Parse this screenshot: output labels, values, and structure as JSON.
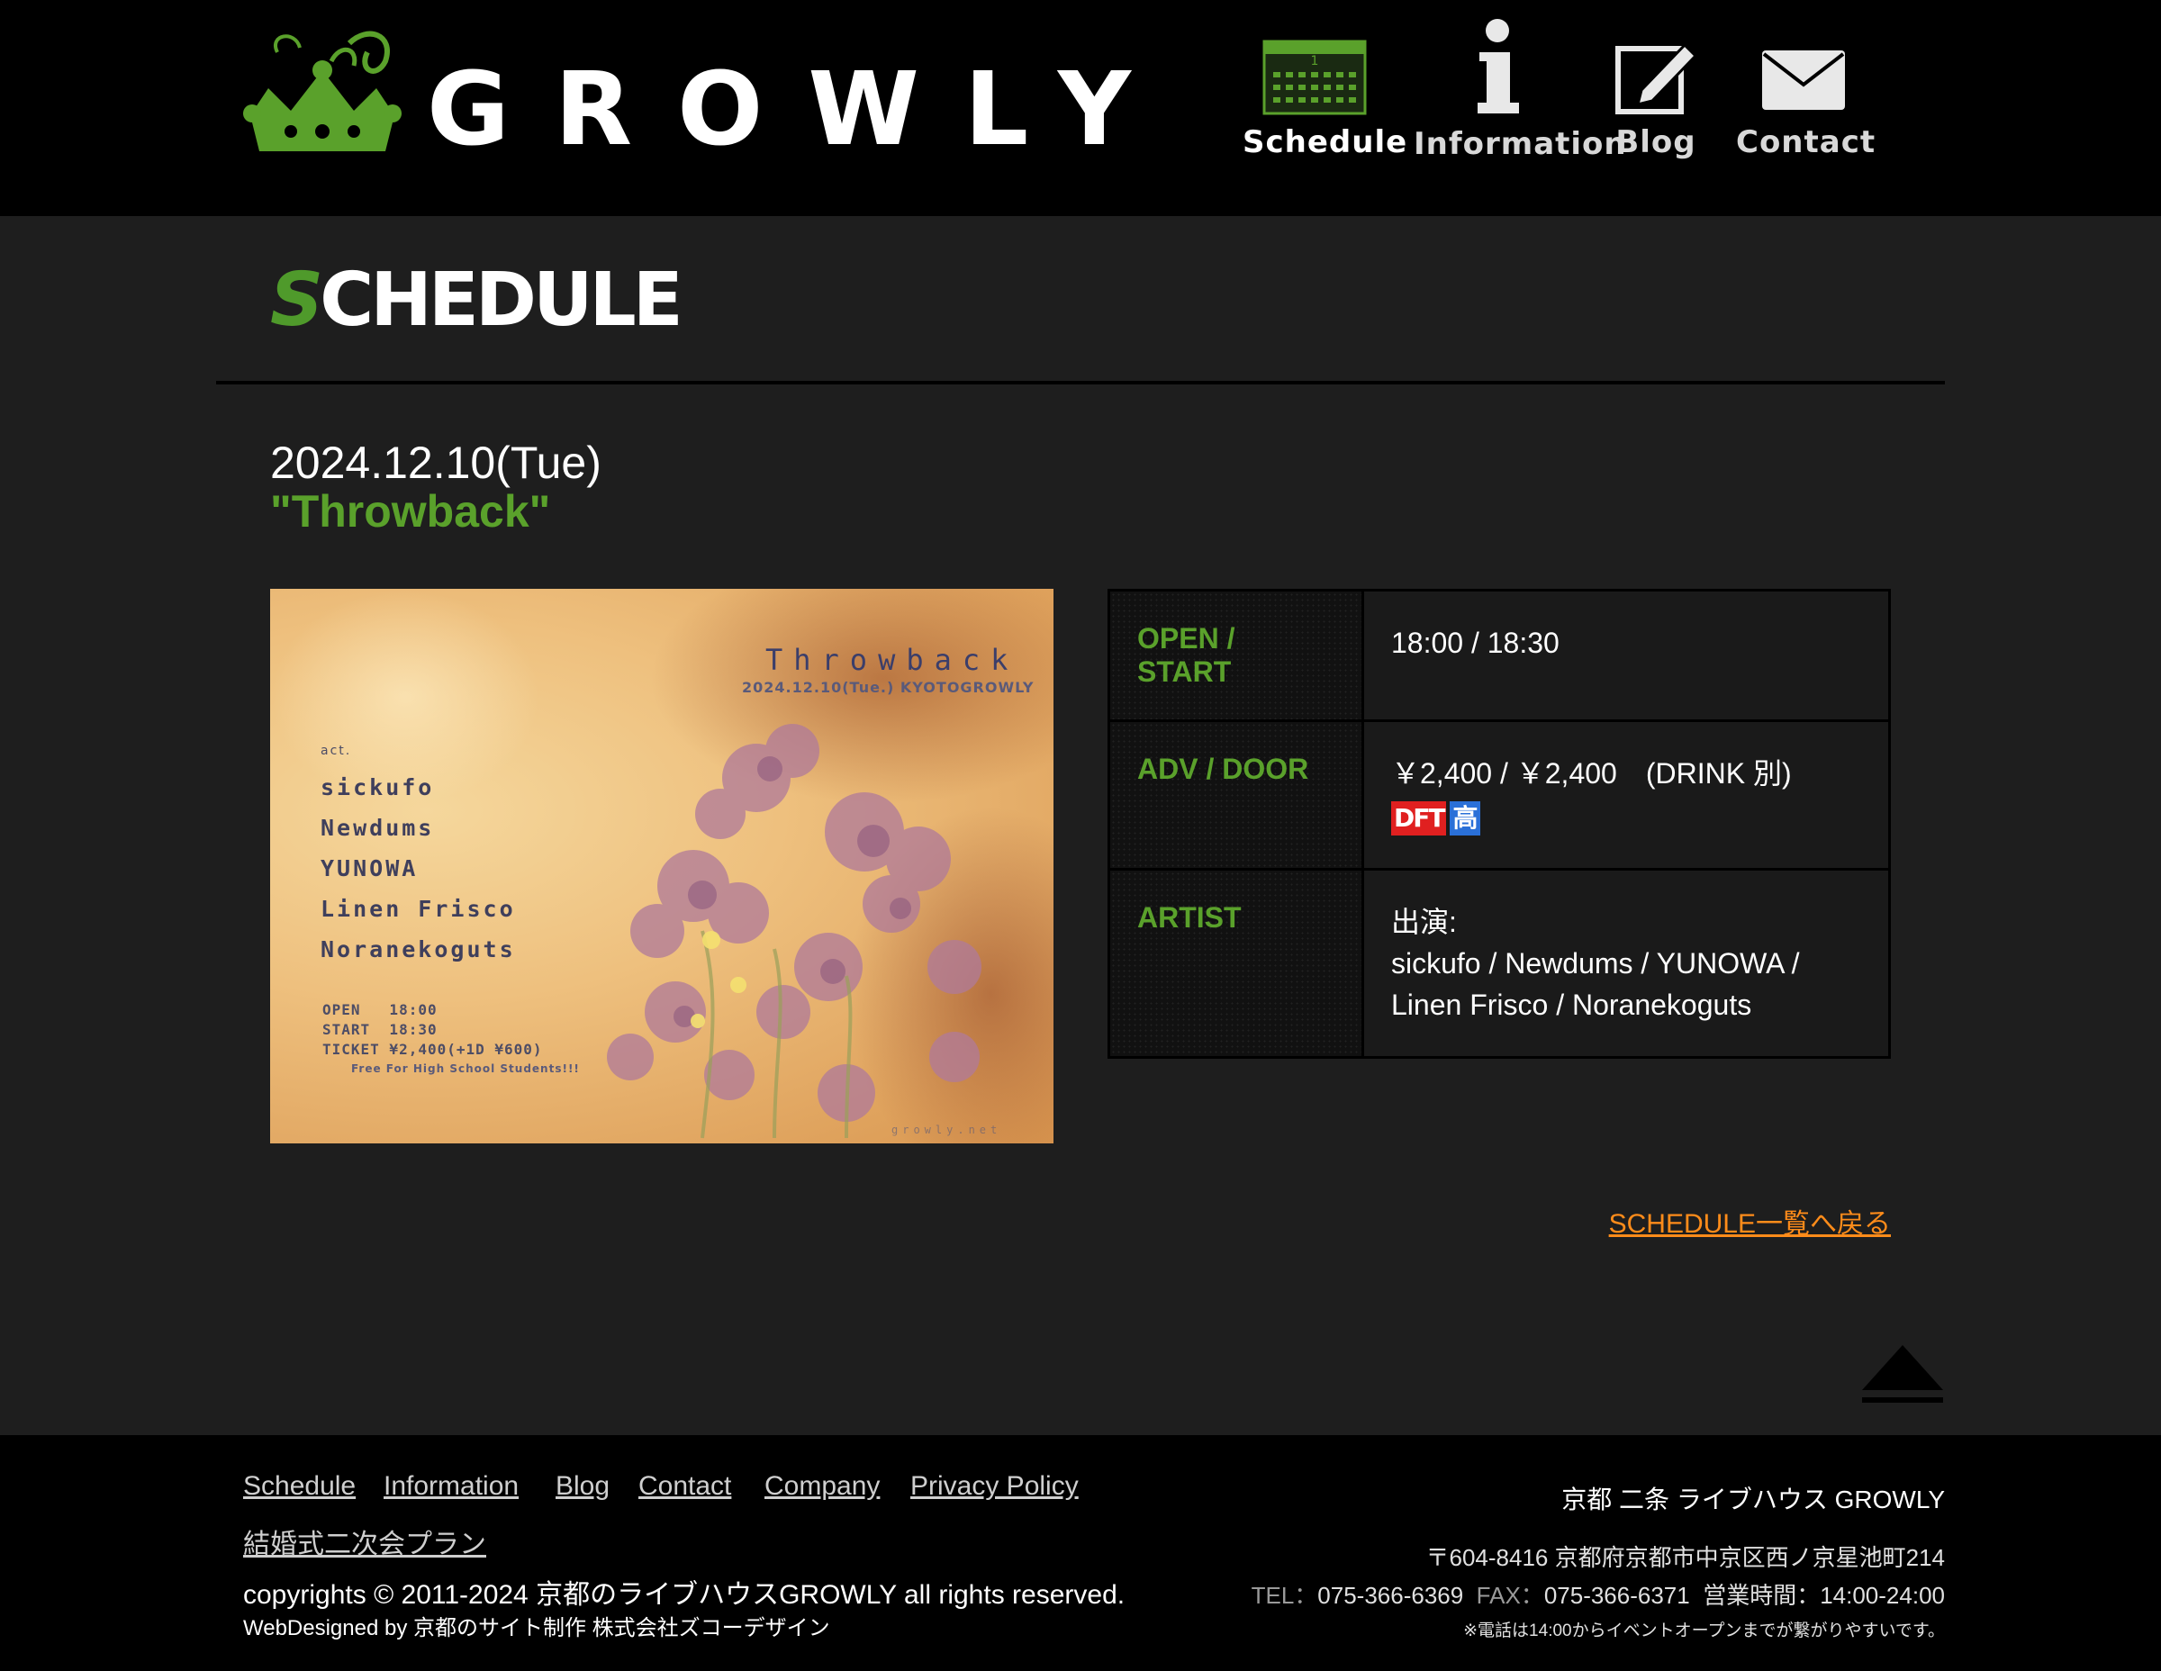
{
  "header": {
    "logo_text": "GROWLY",
    "nav": [
      {
        "label": "Schedule",
        "icon": "calendar-icon"
      },
      {
        "label": "Information",
        "icon": "info-icon"
      },
      {
        "label": "Blog",
        "icon": "pencil-note-icon"
      },
      {
        "label": "Contact",
        "icon": "envelope-icon"
      }
    ],
    "calendar_day": "1"
  },
  "page": {
    "heading_first": "S",
    "heading_rest": "CHEDULE"
  },
  "event": {
    "date": "2024.12.10(Tue)",
    "title": "\"Throwback\"",
    "flyer": {
      "title": "Throwback",
      "subtitle": "2024.12.10(Tue.) KYOTOGROWLY",
      "act_label": "act.",
      "artists": [
        "sickufo",
        "Newdums",
        "YUNOWA",
        "Linen Frisco",
        "Noranekoguts"
      ],
      "open": "OPEN   18:00",
      "start": "START  18:30",
      "ticket": "TICKET ¥2,400(+1D ¥600)",
      "note": "Free For High School Students!!!",
      "footer": "growly.net"
    },
    "table": {
      "open_label": "OPEN / START",
      "open_value": "18:00 / 18:30",
      "adv_label": "ADV / DOOR",
      "adv_value": "￥2,400 / ￥2,400　(DRINK 別)",
      "badge_dft": "DFT",
      "badge_kou": "高",
      "artist_label": "ARTIST",
      "artist_prefix": "出演:",
      "artist_line1": "sickufo / Newdums / YUNOWA /",
      "artist_line2": "Linen Frisco / Noranekoguts"
    },
    "back_link": "SCHEDULE一覧へ戻る"
  },
  "colors": {
    "accent_green": "#5aa12b",
    "link_orange": "#ff8c1a",
    "background": "#1e1e1e"
  },
  "footer": {
    "links": [
      "Schedule",
      "Information",
      "Blog",
      "Contact",
      "Company",
      "Privacy Policy"
    ],
    "plan_link": "結婚式二次会プラン",
    "copyright": "copyrights © 2011-2024 京都のライブハウスGROWLY all rights reserved.",
    "webdesign": "WebDesigned by 京都のサイト制作 株式会社ズコーデザイン",
    "company_name": "京都 二条 ライブハウス GROWLY",
    "address": "〒604-8416 京都府京都市中京区西ノ京星池町214",
    "tel_label": "TEL：",
    "tel": "075-366-6369",
    "fax_label": "FAX：",
    "fax": "075-366-6371",
    "hours_label": "営業時間：",
    "hours": "14:00-24:00",
    "phone_note": "※電話は14:00からイベントオープンまでが繋がりやすいです。"
  }
}
